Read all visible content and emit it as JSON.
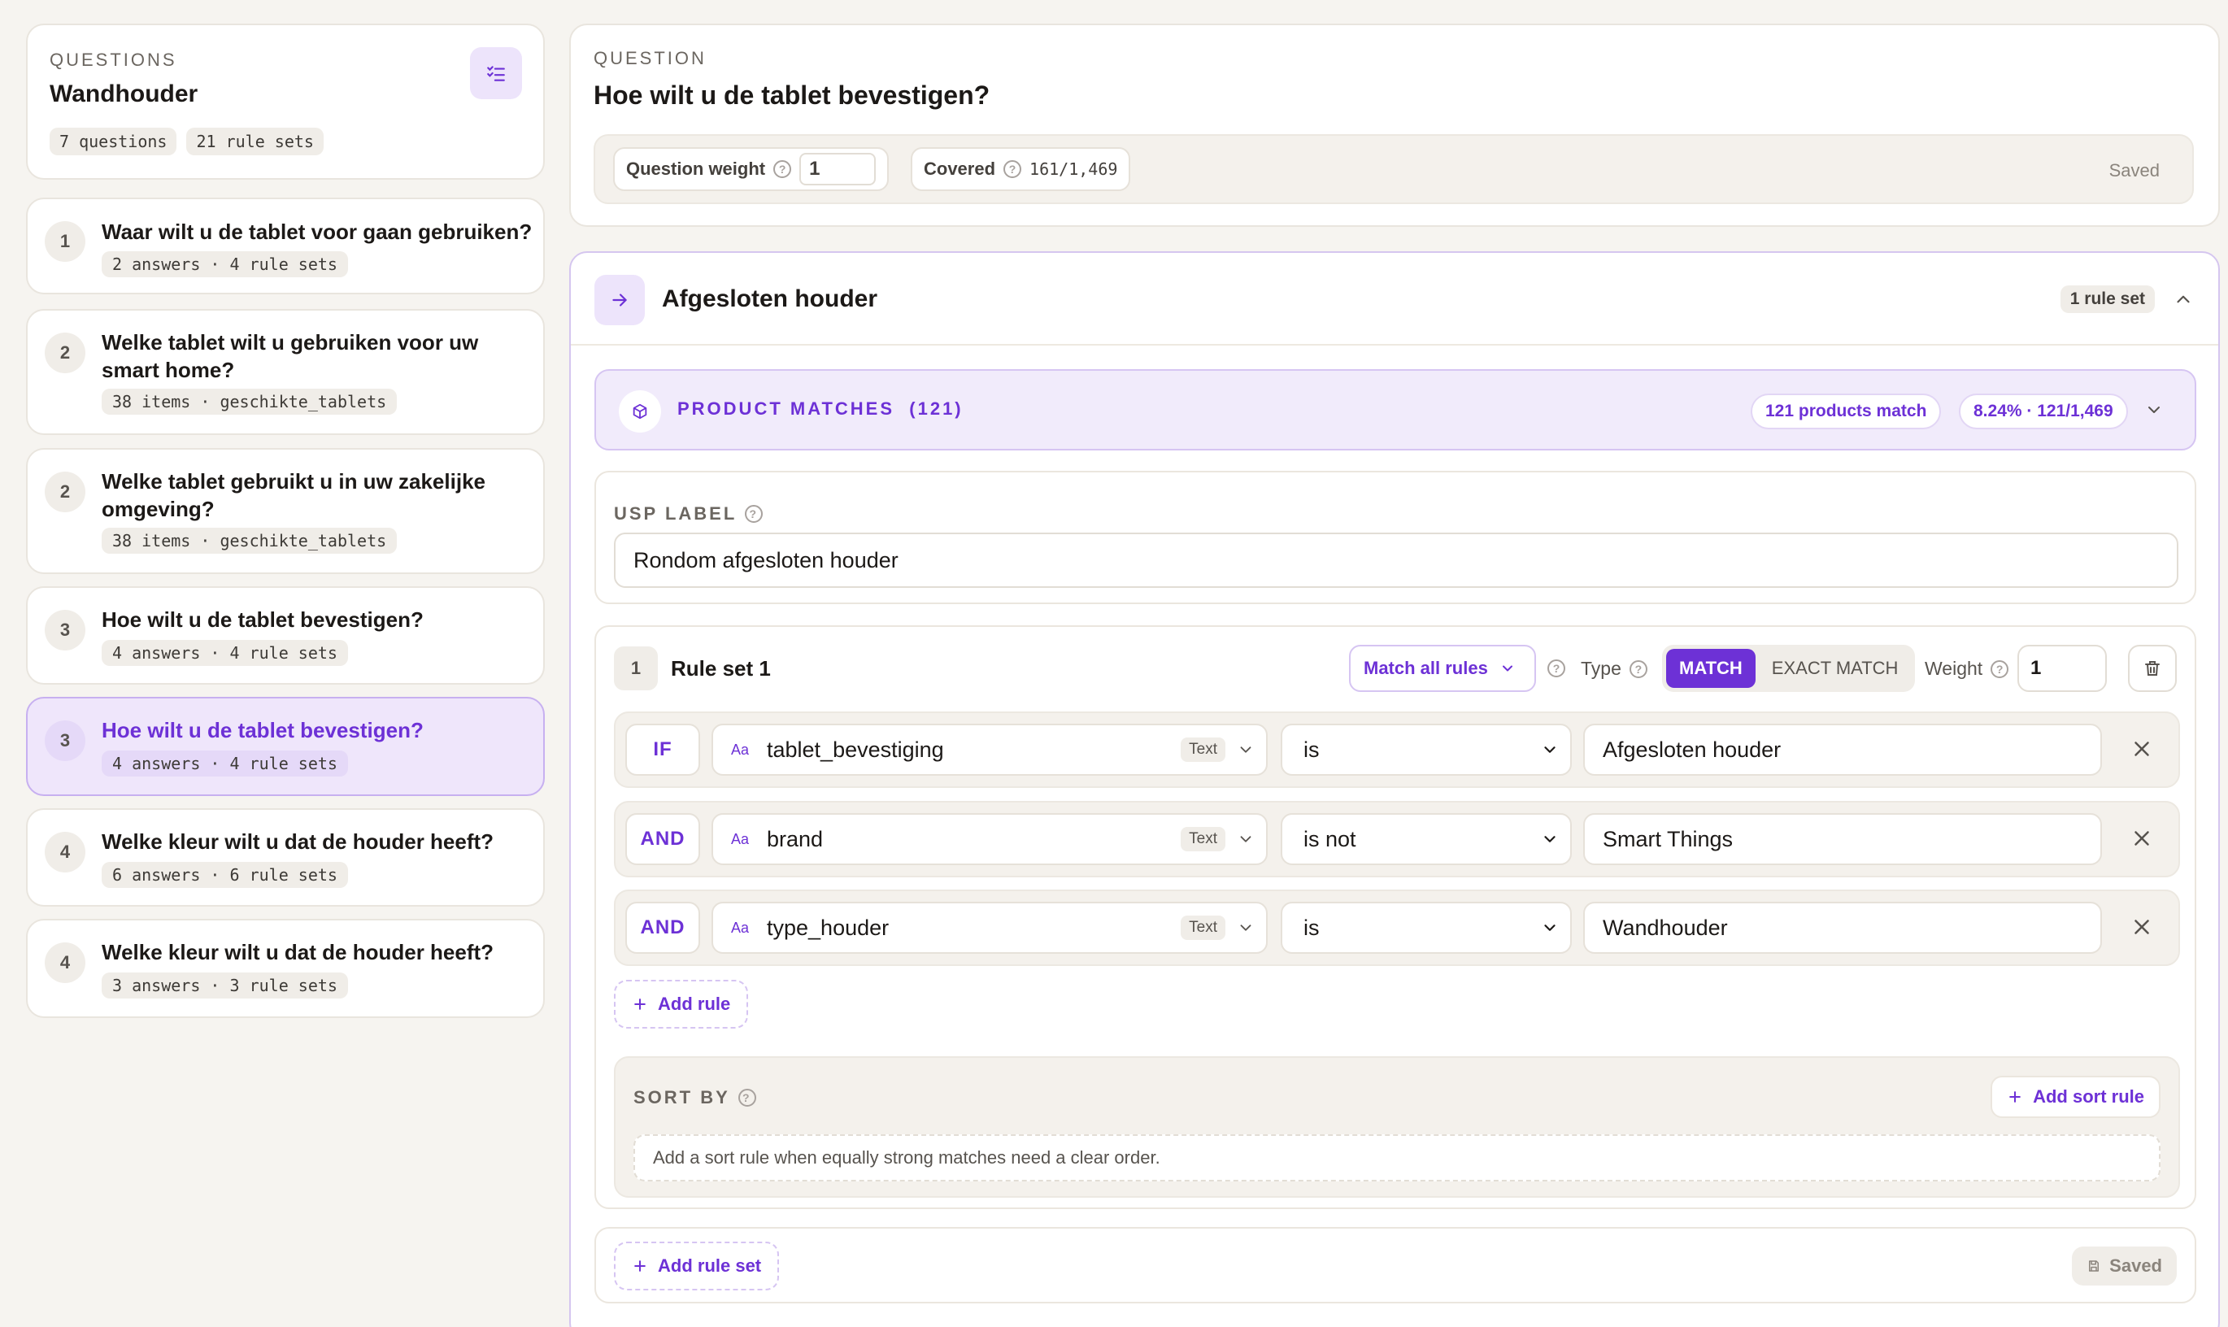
{
  "sidebar": {
    "section_label": "QUESTIONS",
    "title": "Wandhouder",
    "chips": [
      "7 questions",
      "21 rule sets"
    ],
    "icon": "list-check-icon",
    "questions": [
      {
        "num": "1",
        "text": "Waar wilt u de tablet voor gaan gebruiken?",
        "meta": "2 answers · 4 rule sets"
      },
      {
        "num": "2",
        "text": "Welke tablet wilt u gebruiken voor uw smart home?",
        "meta": "38 items · geschikte_tablets"
      },
      {
        "num": "2",
        "text": "Welke tablet gebruikt u in uw zakelijke omgeving?",
        "meta": "38 items · geschikte_tablets"
      },
      {
        "num": "3",
        "text": "Hoe wilt u de tablet bevestigen?",
        "meta": "4 answers · 4 rule sets"
      },
      {
        "num": "3",
        "text": "Hoe wilt u de tablet bevestigen?",
        "meta": "4 answers · 4 rule sets",
        "selected": true
      },
      {
        "num": "4",
        "text": "Welke kleur wilt u dat de houder heeft?",
        "meta": "6 answers · 6 rule sets"
      },
      {
        "num": "4",
        "text": "Welke kleur wilt u dat de houder heeft?",
        "meta": "3 answers · 3 rule sets"
      }
    ]
  },
  "question": {
    "section_label": "QUESTION",
    "title": "Hoe wilt u de tablet bevestigen?",
    "weight_label": "Question weight",
    "weight_value": "1",
    "covered_label": "Covered",
    "covered_value": "161/1,469",
    "status": "Saved"
  },
  "answer": {
    "title": "Afgesloten houder",
    "rule_set_badge": "1 rule set",
    "product_matches": {
      "label": "PRODUCT MATCHES",
      "count": "(121)",
      "badge_products": "121 products match",
      "badge_pct": "8.24% · 121/1,469"
    },
    "usp": {
      "label": "USP LABEL",
      "value": "Rondom afgesloten houder"
    },
    "rule_set": {
      "num": "1",
      "title": "Rule set 1",
      "match_mode": "Match all rules",
      "type_label": "Type",
      "type_options": [
        "MATCH",
        "EXACT MATCH"
      ],
      "type_selected": "MATCH",
      "weight_label": "Weight",
      "weight_value": "1",
      "rules": [
        {
          "op": "IF",
          "field": "tablet_bevestiging",
          "field_type": "Text",
          "comparator": "is",
          "value": "Afgesloten houder"
        },
        {
          "op": "AND",
          "field": "brand",
          "field_type": "Text",
          "comparator": "is not",
          "value": "Smart Things"
        },
        {
          "op": "AND",
          "field": "type_houder",
          "field_type": "Text",
          "comparator": "is",
          "value": "Wandhouder"
        }
      ],
      "add_rule_label": "Add rule",
      "sort": {
        "label": "SORT BY",
        "add_label": "Add sort rule",
        "hint": "Add a sort rule when equally strong matches need a clear order."
      }
    },
    "add_rule_set_label": "Add rule set",
    "footer_status": "Saved"
  },
  "colors": {
    "accent": "#6d31d6",
    "accent_light": "#ede4fb",
    "background": "#f6f4f0"
  }
}
